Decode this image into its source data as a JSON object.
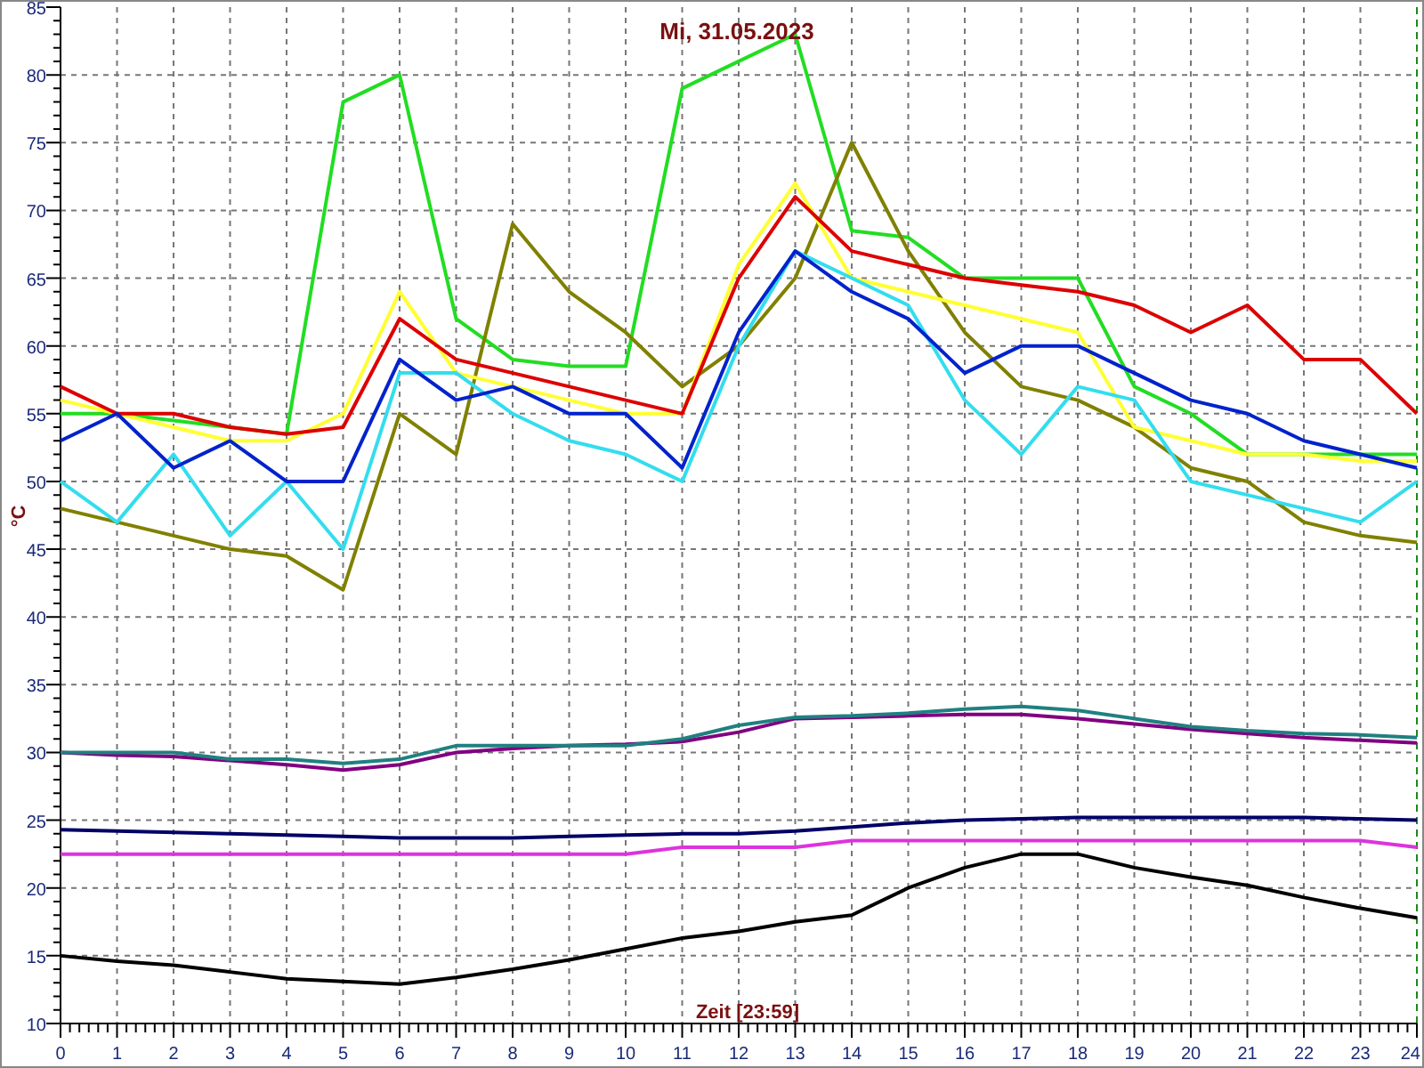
{
  "chart": {
    "chart_data": {
      "type": "line",
      "title": "Mi, 31.05.2023",
      "xlabel": "Zeit [23:59]",
      "ylabel": "°C",
      "x": [
        0,
        1,
        2,
        3,
        4,
        5,
        6,
        7,
        8,
        9,
        10,
        11,
        12,
        13,
        14,
        15,
        16,
        17,
        18,
        19,
        20,
        21,
        22,
        23,
        24
      ],
      "grid": true,
      "xlim": [
        0,
        24
      ],
      "ylim": [
        10,
        85
      ],
      "xticks": [
        0,
        1,
        2,
        3,
        4,
        5,
        6,
        7,
        8,
        9,
        10,
        11,
        12,
        13,
        14,
        15,
        16,
        17,
        18,
        19,
        20,
        21,
        22,
        23,
        24
      ],
      "yticks": [
        10,
        15,
        20,
        25,
        30,
        35,
        40,
        45,
        50,
        55,
        60,
        65,
        70,
        75,
        80,
        85
      ],
      "series": [
        {
          "color": "#22dd22",
          "values": [
            55,
            55,
            54.5,
            54,
            53.5,
            78,
            80,
            62,
            59,
            58.5,
            58.5,
            79,
            81,
            83,
            68.5,
            68,
            65,
            65,
            65,
            57,
            55,
            52,
            52,
            52,
            52
          ]
        },
        {
          "color": "#808000",
          "values": [
            48,
            47,
            46,
            45,
            44.5,
            42,
            55,
            52,
            69,
            64,
            61,
            57,
            60,
            65,
            75,
            67,
            61,
            57,
            56,
            54,
            51,
            50,
            47,
            46,
            45.5
          ]
        },
        {
          "color": "#ffff33",
          "values": [
            56,
            55,
            54,
            53,
            53,
            55,
            64,
            58,
            57,
            56,
            55,
            55,
            66,
            72,
            65,
            64,
            63,
            62,
            61,
            54,
            53,
            52,
            52,
            51.5,
            51.5
          ]
        },
        {
          "color": "#33ddee",
          "values": [
            50,
            47,
            52,
            46,
            50,
            45,
            58,
            58,
            55,
            53,
            52,
            50,
            60,
            67,
            65,
            63,
            56,
            52,
            57,
            56,
            50,
            49,
            48,
            47,
            50
          ]
        },
        {
          "color": "#dd0000",
          "values": [
            57,
            55,
            55,
            54,
            53.5,
            54,
            62,
            59,
            58,
            57,
            56,
            55,
            65,
            71,
            67,
            66,
            65,
            64.5,
            64,
            63,
            61,
            63,
            59,
            59,
            55
          ]
        },
        {
          "color": "#0022cc",
          "values": [
            53,
            55,
            51,
            53,
            50,
            50,
            59,
            56,
            57,
            55,
            55,
            51,
            61,
            67,
            64,
            62,
            58,
            60,
            60,
            58,
            56,
            55,
            53,
            52,
            51
          ]
        },
        {
          "color": "#800080",
          "values": [
            30,
            29.8,
            29.7,
            29.4,
            29.1,
            28.7,
            29.1,
            30,
            30.3,
            30.5,
            30.6,
            30.8,
            31.5,
            32.5,
            32.6,
            32.7,
            32.8,
            32.8,
            32.5,
            32.1,
            31.7,
            31.4,
            31.1,
            30.9,
            30.7
          ]
        },
        {
          "color": "#208080",
          "values": [
            30,
            30,
            30,
            29.5,
            29.5,
            29.2,
            29.5,
            30.5,
            30.5,
            30.5,
            30.5,
            31,
            32,
            32.6,
            32.7,
            32.9,
            33.2,
            33.4,
            33.1,
            32.5,
            31.9,
            31.6,
            31.4,
            31.3,
            31.1
          ]
        },
        {
          "color": "#000066",
          "values": [
            24.3,
            24.2,
            24.1,
            24,
            23.9,
            23.8,
            23.7,
            23.7,
            23.7,
            23.8,
            23.9,
            24,
            24,
            24.2,
            24.5,
            24.8,
            25,
            25.1,
            25.2,
            25.2,
            25.2,
            25.2,
            25.2,
            25.1,
            25
          ]
        },
        {
          "color": "#dd33dd",
          "values": [
            22.5,
            22.5,
            22.5,
            22.5,
            22.5,
            22.5,
            22.5,
            22.5,
            22.5,
            22.5,
            22.5,
            23,
            23,
            23,
            23.5,
            23.5,
            23.5,
            23.5,
            23.5,
            23.5,
            23.5,
            23.5,
            23.5,
            23.5,
            23
          ]
        },
        {
          "color": "#000000",
          "values": [
            15,
            14.6,
            14.3,
            13.8,
            13.3,
            13.1,
            12.9,
            13.4,
            14,
            14.7,
            15.5,
            16.3,
            16.8,
            17.5,
            18,
            20,
            21.5,
            22.5,
            22.5,
            21.5,
            20.8,
            20.2,
            19.3,
            18.5,
            17.8
          ]
        }
      ]
    }
  }
}
